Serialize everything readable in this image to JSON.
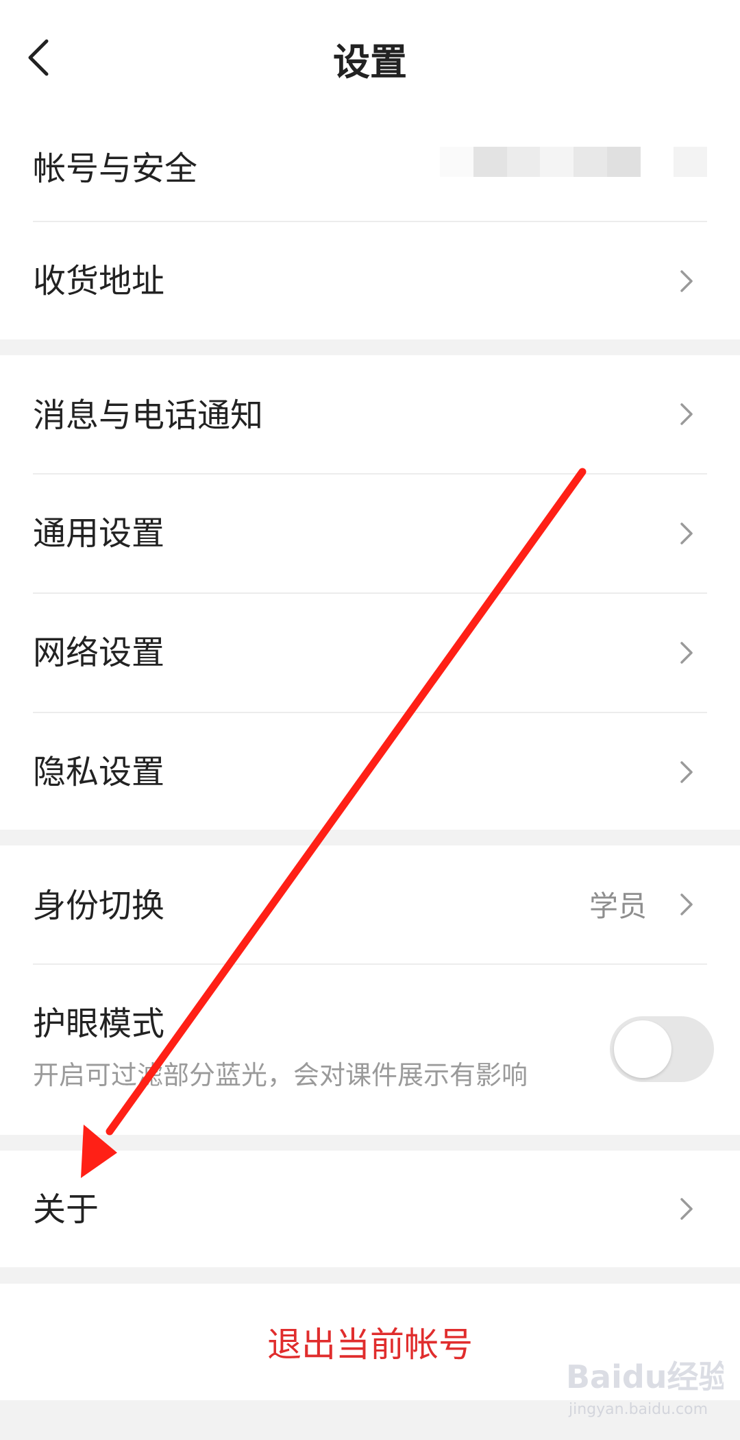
{
  "header": {
    "title": "设置"
  },
  "groups": {
    "account": {
      "account_security": "帐号与安全",
      "address": "收货地址"
    },
    "settings": {
      "notifications": "消息与电话通知",
      "general": "通用设置",
      "network": "网络设置",
      "privacy": "隐私设置"
    },
    "identity": {
      "switch_label": "身份切换",
      "switch_value": "学员",
      "eye_mode_label": "护眼模式",
      "eye_mode_desc": "开启可过滤部分蓝光，会对课件展示有影响",
      "eye_mode_on": false
    },
    "about": {
      "label": "关于"
    }
  },
  "logout": {
    "label": "退出当前帐号"
  },
  "watermark": {
    "text": "Baidu经验",
    "url": "jingyan.baidu.com"
  },
  "colors": {
    "accent_red": "#e02d2d",
    "arrow_red": "#ff2016"
  }
}
